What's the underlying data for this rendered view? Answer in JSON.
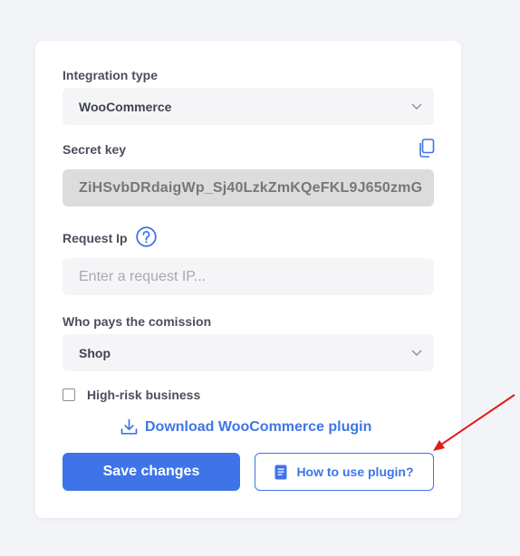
{
  "integration": {
    "label": "Integration type",
    "selected": "WooCommerce"
  },
  "secret": {
    "label": "Secret key",
    "value": "ZiHSvbDRdaigWp_Sj40LzkZmKQeFKL9J650zmG"
  },
  "request_ip": {
    "label": "Request Ip",
    "placeholder": "Enter a request IP..."
  },
  "commission": {
    "label": "Who pays the comission",
    "selected": "Shop"
  },
  "high_risk": {
    "label": "High-risk business",
    "checked": false
  },
  "download": {
    "label": "Download WooCommerce plugin"
  },
  "buttons": {
    "save": "Save changes",
    "how_to": "How to use plugin?"
  },
  "colors": {
    "accent": "#3e74e8",
    "annotation_arrow": "#e01b1b"
  },
  "icons": [
    "chevron-down-icon",
    "copy-icon",
    "help-icon",
    "download-icon",
    "document-icon"
  ]
}
